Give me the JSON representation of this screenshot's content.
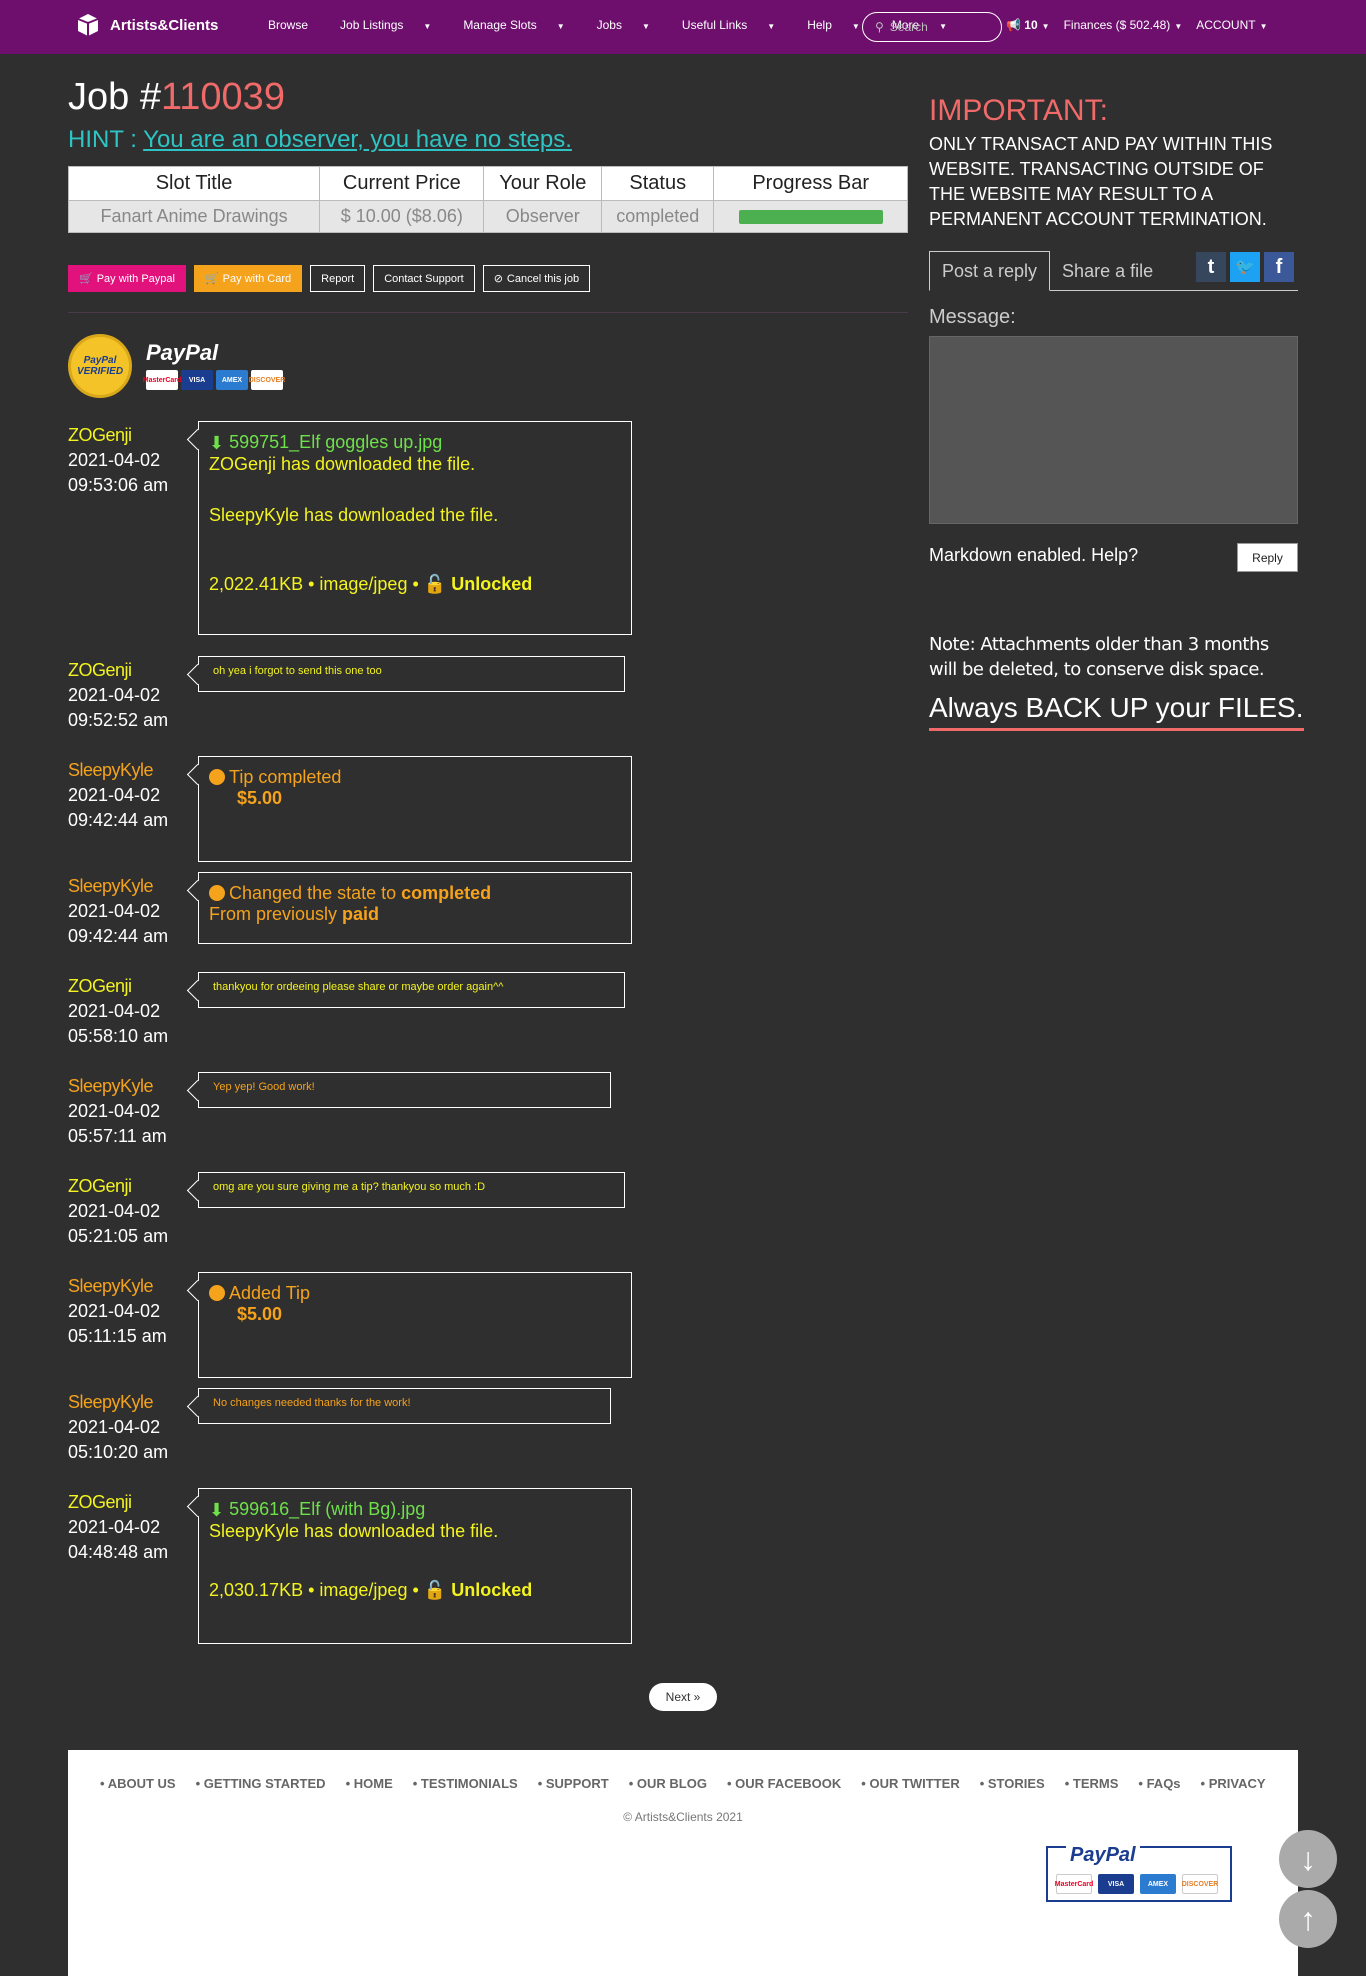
{
  "nav": {
    "brand": "Artists&Clients",
    "links": [
      "Browse",
      "Job Listings",
      "Manage Slots",
      "Jobs",
      "Useful Links",
      "Help",
      "More"
    ],
    "search_placeholder": "Search",
    "notifications": "10",
    "finances": "Finances ($ 502.48)",
    "account": "ACCOUNT"
  },
  "job": {
    "title_prefix": "Job #",
    "number": "110039",
    "hint_label": "HINT :",
    "hint_text": "You are an observer, you have no steps."
  },
  "table": {
    "headers": [
      "Slot Title",
      "Current Price",
      "Your Role",
      "Status",
      "Progress Bar"
    ],
    "row": [
      "Fanart Anime Drawings",
      "$ 10.00 ($8.06)",
      "Observer",
      "completed"
    ],
    "progress": 1.0
  },
  "actions": {
    "pay_paypal": "Pay with Paypal",
    "pay_card": "Pay with Card",
    "report": "Report",
    "contact": "Contact Support",
    "cancel": "Cancel this job"
  },
  "paypal": {
    "verified": "PayPal VERIFIED",
    "logo": "PayPal",
    "cards": [
      "MasterCard",
      "VISA",
      "AMEX",
      "DISCOVER"
    ]
  },
  "feed": [
    {
      "user": "ZOGenji",
      "date": "2021-04-02",
      "time": "09:53:06 am",
      "file": "599751_Elf goggles up.jpg",
      "line1": "ZOGenji has downloaded the file.",
      "line2": "SleepyKyle has downloaded the file.",
      "size": "2,022.41KB",
      "type": "image/jpeg",
      "lock": "Unlocked"
    },
    {
      "user": "ZOGenji",
      "date": "2021-04-02",
      "time": "09:52:52 am",
      "message": "oh yea i forgot to send this one too"
    },
    {
      "user": "SleepyKyle",
      "date": "2021-04-02",
      "time": "09:42:44 am",
      "event": "Tip completed",
      "amount": "$5.00"
    },
    {
      "user": "SleepyKyle",
      "date": "2021-04-02",
      "time": "09:42:44 am",
      "event_prefix": "Changed the state to",
      "event_value": "completed",
      "from_prefix": "From previously",
      "from_value": "paid"
    },
    {
      "user": "ZOGenji",
      "date": "2021-04-02",
      "time": "05:58:10 am",
      "message": "thankyou for ordeeing please share or maybe order again^^"
    },
    {
      "user": "SleepyKyle",
      "date": "2021-04-02",
      "time": "05:57:11 am",
      "message": "Yep yep! Good work!"
    },
    {
      "user": "ZOGenji",
      "date": "2021-04-02",
      "time": "05:21:05 am",
      "message": "omg are you sure giving me a tip? thankyou so much :D"
    },
    {
      "user": "SleepyKyle",
      "date": "2021-04-02",
      "time": "05:11:15 am",
      "event": "Added Tip",
      "amount": "$5.00"
    },
    {
      "user": "SleepyKyle",
      "date": "2021-04-02",
      "time": "05:10:20 am",
      "message": "No changes needed thanks for the work!"
    },
    {
      "user": "ZOGenji",
      "date": "2021-04-02",
      "time": "04:48:48 am",
      "file": "599616_Elf (with Bg).jpg",
      "line1": "SleepyKyle has downloaded the file.",
      "size": "2,030.17KB",
      "type": "image/jpeg",
      "lock": "Unlocked"
    }
  ],
  "sidebar": {
    "important_title": "IMPORTANT:",
    "important_text": "ONLY TRANSACT AND PAY WITHIN THIS WEBSITE. TRANSACTING OUTSIDE OF THE WEBSITE MAY RESULT TO A PERMANENT ACCOUNT TERMINATION.",
    "tab_reply": "Post a reply",
    "tab_share": "Share a file",
    "message_label": "Message:",
    "markdown": "Markdown enabled. Help?",
    "reply": "Reply",
    "note": "Note: Attachments older than 3 months will be deleted, to conserve disk space.",
    "backup": "Always BACK UP your FILES."
  },
  "pagination": {
    "next": "Next »"
  },
  "footer": {
    "links": [
      "ABOUT US",
      "GETTING STARTED",
      "HOME",
      "TESTIMONIALS",
      "SUPPORT",
      "OUR BLOG",
      "OUR FACEBOOK",
      "OUR TWITTER",
      "STORIES",
      "TERMS",
      "FAQs",
      "PRIVACY"
    ],
    "copyright": "© Artists&Clients 2021",
    "paypal": "PayPal"
  },
  "colors": {
    "nav": "#6e0f6e",
    "accent_yellow": "#f3f320",
    "accent_orange": "#f5a21c",
    "accent_red": "#f06a6a",
    "hint": "#2ec4c4"
  }
}
